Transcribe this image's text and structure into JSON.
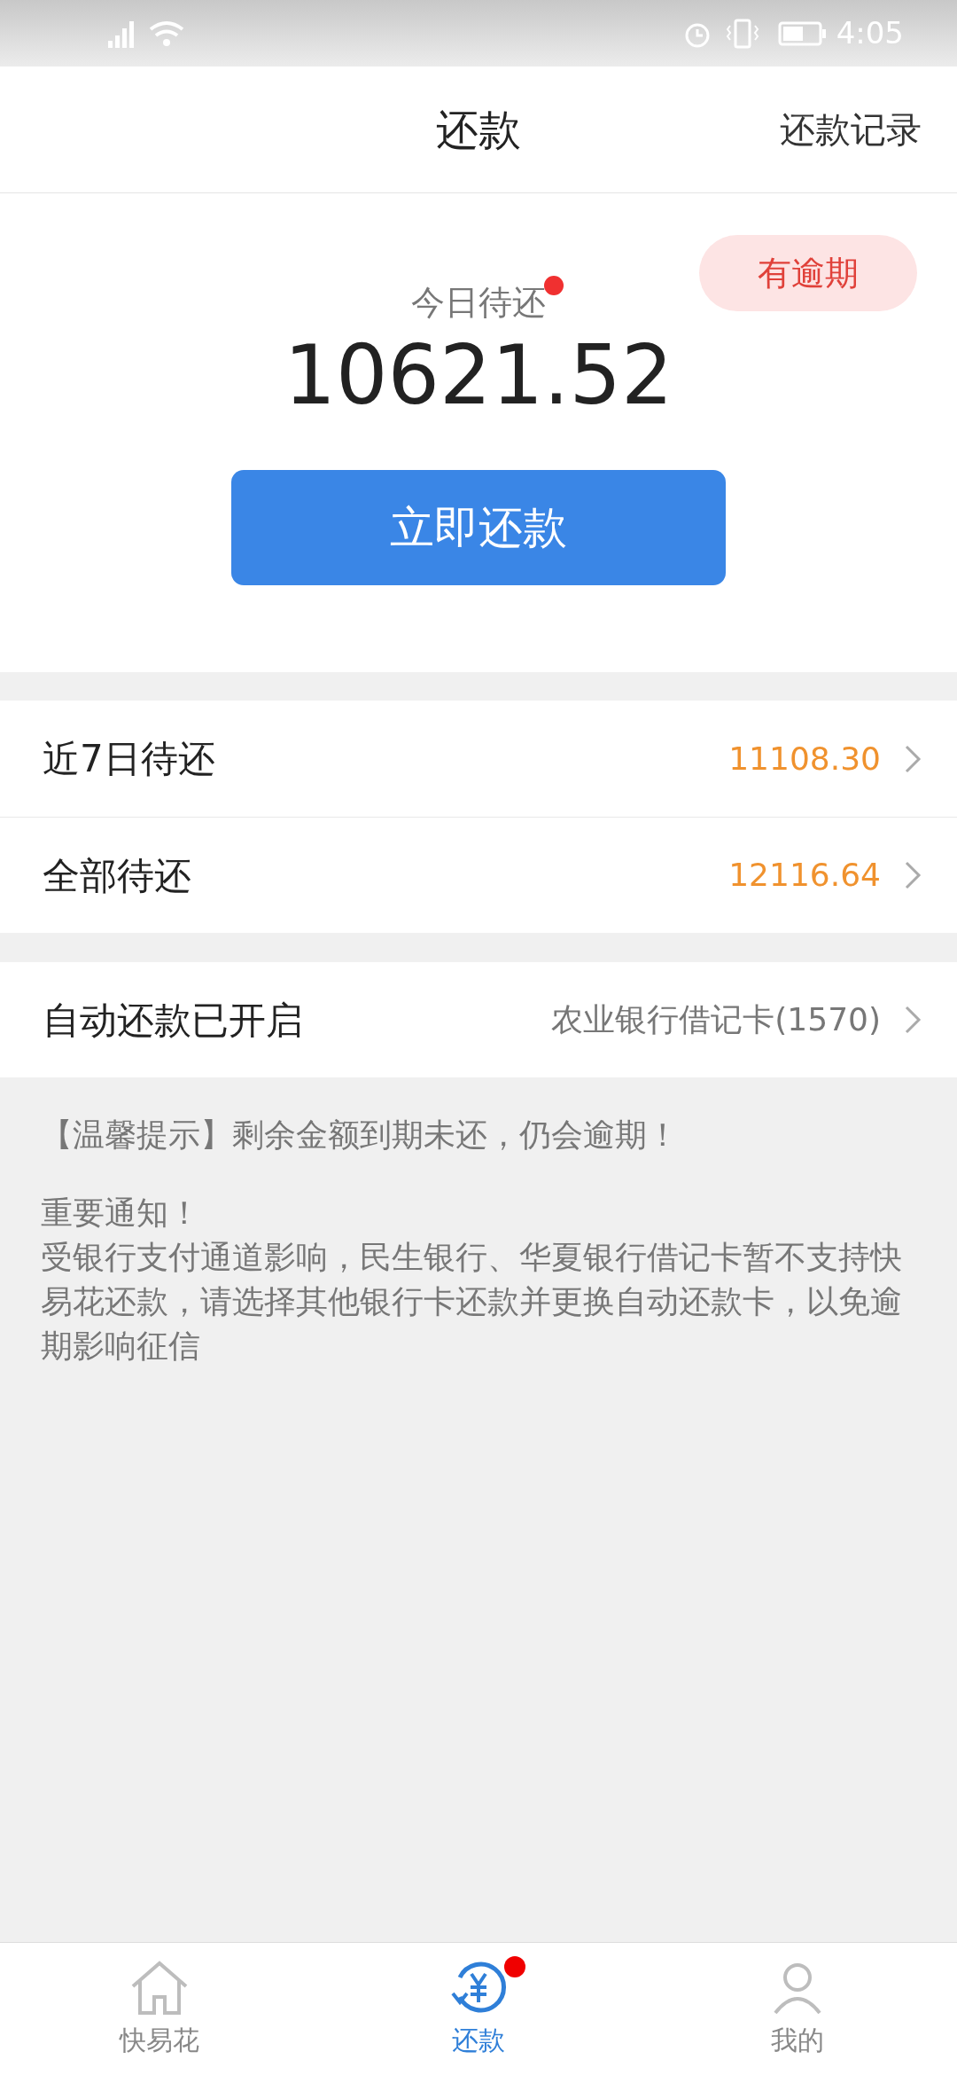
{
  "status_bar": {
    "time": "4:05"
  },
  "header": {
    "title": "还款",
    "action": "还款记录"
  },
  "summary": {
    "badge": "有逾期",
    "label": "今日待还",
    "has_dot": true,
    "amount": "10621.52",
    "button": "立即还款"
  },
  "due_rows": [
    {
      "label": "近7日待还",
      "value": "11108.30"
    },
    {
      "label": "全部待还",
      "value": "12116.64"
    }
  ],
  "auto_repay": {
    "label": "自动还款已开启",
    "value": "农业银行借记卡(1570)"
  },
  "tip": "【温馨提示】剩余金额到期未还，仍会逾期！",
  "notice": {
    "title": "重要通知！",
    "body": "受银行支付通道影响，民生银行、华夏银行借记卡暂不支持快易花还款，请选择其他银行卡还款并更换自动还款卡，以免逾期影响征信"
  },
  "tabs": [
    {
      "label": "快易花",
      "kind": "home",
      "selected": false,
      "dot": false
    },
    {
      "label": "还款",
      "kind": "repay",
      "selected": true,
      "dot": true
    },
    {
      "label": "我的",
      "kind": "profile",
      "selected": false,
      "dot": false
    }
  ]
}
